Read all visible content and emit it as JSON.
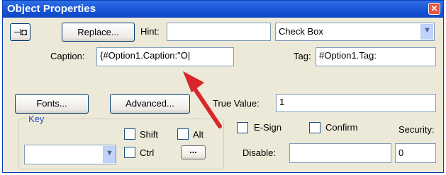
{
  "window": {
    "title": "Object Properties"
  },
  "toolbar": {
    "replace_label": "Replace...",
    "hint_label": "Hint:",
    "hint_value": "",
    "type_select": "Check Box"
  },
  "caption": {
    "label": "Caption:",
    "value": "{#Option1.Caption:\"O|"
  },
  "tag": {
    "label": "Tag:",
    "value": "#Option1.Tag:"
  },
  "buttons": {
    "fonts": "Fonts...",
    "advanced": "Advanced..."
  },
  "true_value": {
    "label": "True Value:",
    "value": "1"
  },
  "key": {
    "legend": "Key",
    "select_value": "",
    "shift": "Shift",
    "alt": "Alt",
    "ctrl": "Ctrl",
    "more": "..."
  },
  "options": {
    "esign": "E-Sign",
    "confirm": "Confirm",
    "security": "Security:"
  },
  "disable": {
    "label": "Disable:",
    "value": ""
  },
  "security_value": "0",
  "colors": {
    "titlebar": "#1452d4",
    "annotation_arrow": "#d9262b",
    "legend": "#1f4fd1"
  }
}
